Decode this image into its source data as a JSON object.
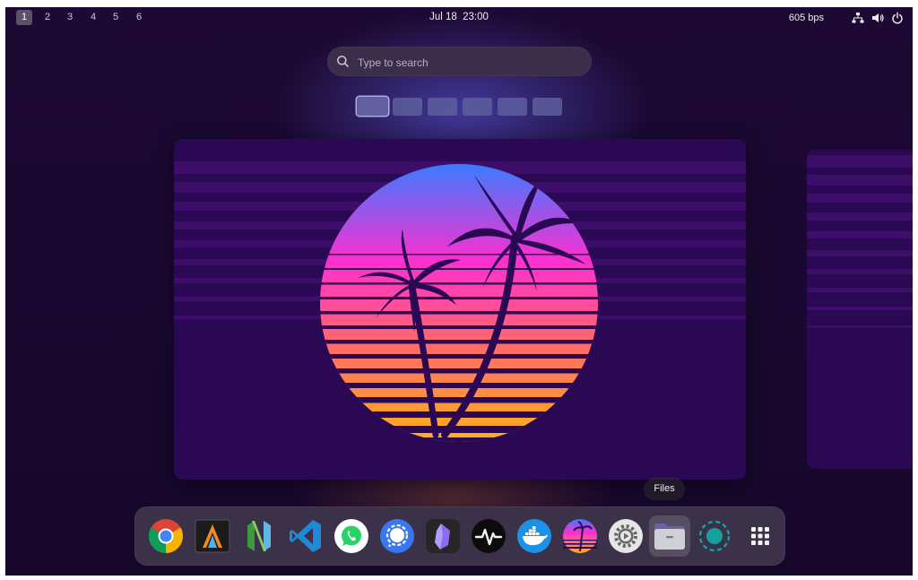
{
  "topbar": {
    "workspaces": [
      "1",
      "2",
      "3",
      "4",
      "5",
      "6"
    ],
    "active_workspace": "1",
    "date": "Jul 18",
    "time": "23:00",
    "netspeed": "605 bps",
    "tray_icons": [
      "network-icon",
      "volume-icon",
      "power-icon"
    ]
  },
  "search": {
    "placeholder": "Type to search"
  },
  "workspace_thumbnails": {
    "count": 6,
    "active_index": 0
  },
  "tooltip": {
    "label": "Files"
  },
  "dock": {
    "apps": [
      {
        "name": "Google Chrome",
        "icon": "chrome-icon"
      },
      {
        "name": "Alacritty",
        "icon": "alacritty-icon"
      },
      {
        "name": "Neovim",
        "icon": "neovim-icon"
      },
      {
        "name": "Visual Studio Code",
        "icon": "vscode-icon"
      },
      {
        "name": "WhatsApp",
        "icon": "whatsapp-icon"
      },
      {
        "name": "Signal",
        "icon": "signal-icon"
      },
      {
        "name": "Obsidian",
        "icon": "obsidian-icon"
      },
      {
        "name": "System Monitor",
        "icon": "activity-icon"
      },
      {
        "name": "Docker",
        "icon": "docker-icon"
      },
      {
        "name": "Wallpaper",
        "icon": "sunset-icon"
      },
      {
        "name": "Settings",
        "icon": "settings-icon"
      },
      {
        "name": "Files",
        "icon": "files-icon"
      },
      {
        "name": "Screen Recorder",
        "icon": "recorder-icon"
      },
      {
        "name": "Show Applications",
        "icon": "app-grid-icon"
      }
    ],
    "hovered": "Files"
  },
  "colors": {
    "background": "#1a0830",
    "window": "#2a0854",
    "sun_top": "#3a7bff",
    "sun_mid": "#ff2fd0",
    "sun_bottom": "#ffb21a",
    "palm": "#2a0854"
  }
}
